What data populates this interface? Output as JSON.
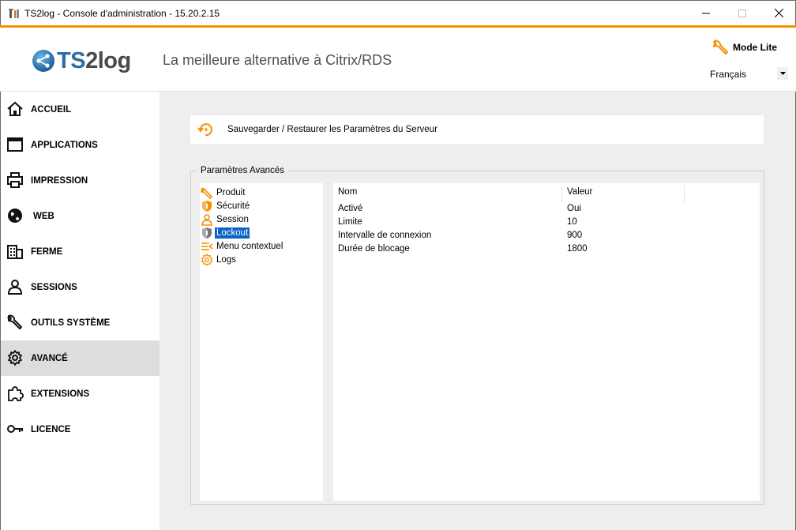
{
  "window": {
    "title": "TS2log - Console d'administration - 15.20.2.15"
  },
  "header": {
    "logo": {
      "ts": "TS",
      "two": "2",
      "log": "log"
    },
    "tagline": "La meilleure alternative à Citrix/RDS",
    "mode_label": "Mode Lite",
    "language": "Français"
  },
  "sidebar": {
    "items": [
      {
        "label": "ACCUEIL",
        "icon": "home-icon"
      },
      {
        "label": "APPLICATIONS",
        "icon": "window-icon"
      },
      {
        "label": "IMPRESSION",
        "icon": "printer-icon"
      },
      {
        "label": "WEB",
        "icon": "globe-icon"
      },
      {
        "label": "FERME",
        "icon": "building-icon"
      },
      {
        "label": "SESSIONS",
        "icon": "user-icon"
      },
      {
        "label": "OUTILS SYSTÈME",
        "icon": "wrench-icon"
      },
      {
        "label": "AVANCÉ",
        "icon": "gear-icon",
        "active": true
      },
      {
        "label": "EXTENSIONS",
        "icon": "puzzle-icon"
      },
      {
        "label": "LICENCE",
        "icon": "key-icon"
      }
    ]
  },
  "main": {
    "save_restore": "Sauvegarder / Restaurer les Paramètres du Serveur",
    "advanced": {
      "legend": "Paramètres Avancés",
      "tree": [
        {
          "label": "Produit",
          "icon": "wrench-icon"
        },
        {
          "label": "Sécurité",
          "icon": "shield-icon"
        },
        {
          "label": "Session",
          "icon": "user-icon"
        },
        {
          "label": "Lockout",
          "icon": "shield-lock-icon",
          "selected": true
        },
        {
          "label": "Menu contextuel",
          "icon": "menu-icon"
        },
        {
          "label": "Logs",
          "icon": "gear-icon"
        }
      ],
      "columns": {
        "name": "Nom",
        "value": "Valeur"
      },
      "rows": [
        {
          "name": "Activé",
          "value": "Oui"
        },
        {
          "name": "Limite",
          "value": "10"
        },
        {
          "name": "Intervalle de connexion",
          "value": "900"
        },
        {
          "name": "Durée de blocage",
          "value": "1800"
        }
      ]
    }
  },
  "colors": {
    "accent": "#f39200",
    "selection": "#0a64c8",
    "logo_blue": "#2a6ea6"
  }
}
